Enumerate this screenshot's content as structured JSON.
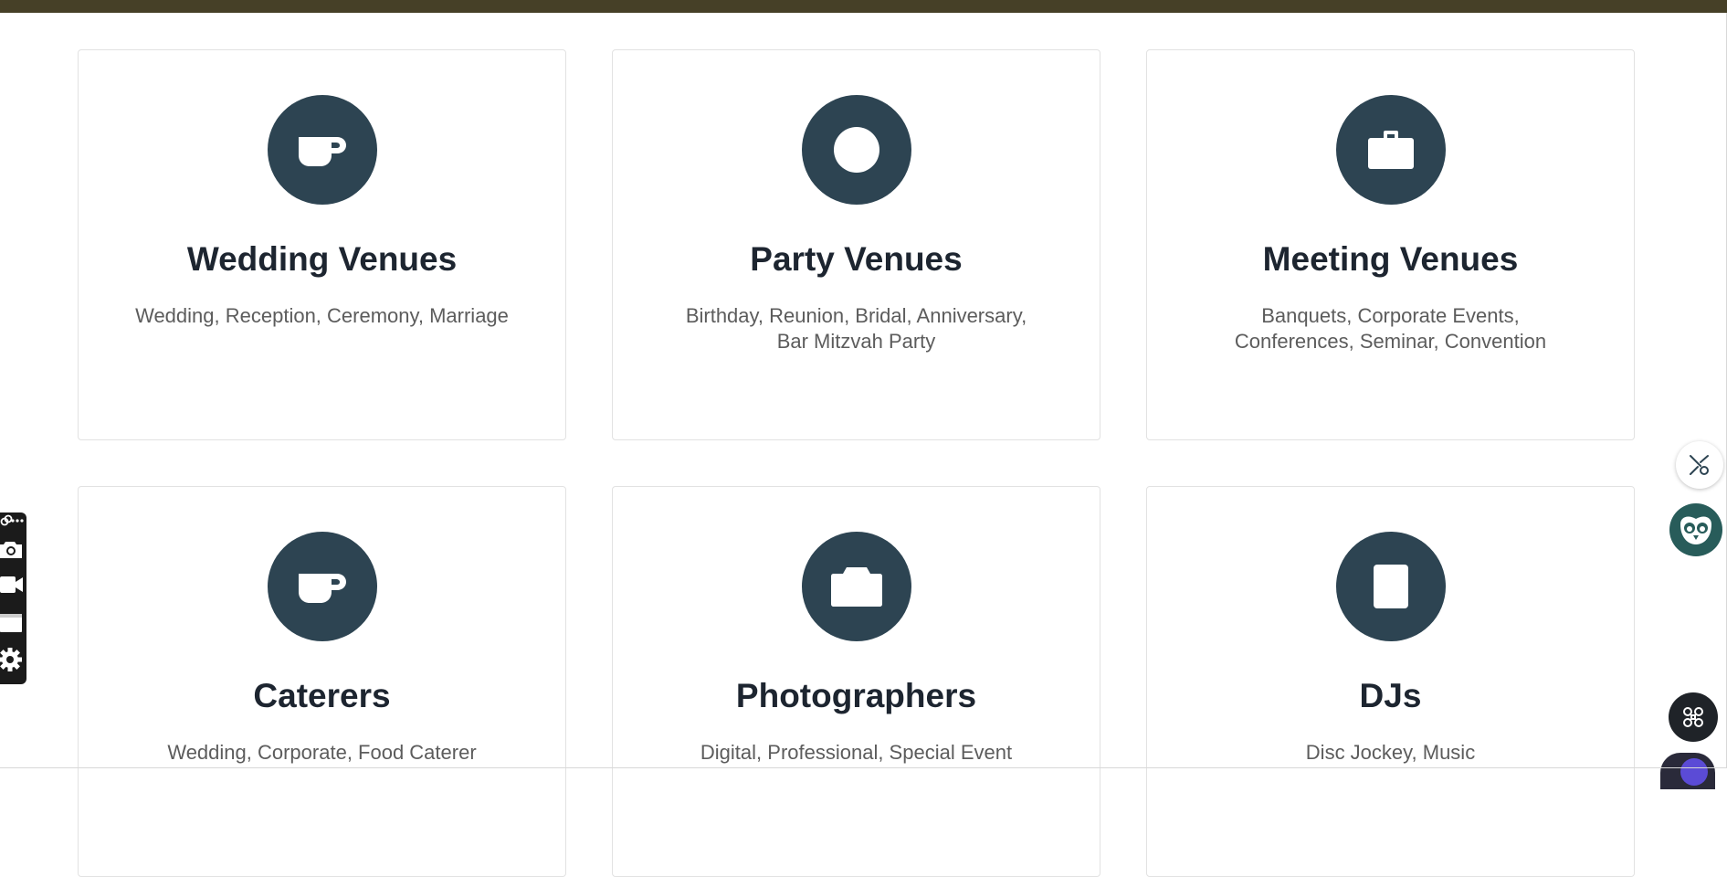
{
  "colors": {
    "top_bar": "#464027",
    "icon_circle": "#2d4452",
    "title_text": "#1d2530",
    "desc_text": "#5c5c5c"
  },
  "categories": [
    {
      "title": "Wedding Venues",
      "description": "Wedding, Reception, Ceremony, Marriage",
      "icon": "coffee-cup-icon"
    },
    {
      "title": "Party Venues",
      "description": "Birthday, Reunion, Bridal, Anniversary, Bar Mitzvah Party",
      "icon": "circle-icon"
    },
    {
      "title": "Meeting Venues",
      "description": "Banquets, Corporate Events, Conferences, Seminar, Convention",
      "icon": "briefcase-icon"
    },
    {
      "title": "Caterers",
      "description": "Wedding, Corporate, Food Caterer",
      "icon": "coffee-cup-icon"
    },
    {
      "title": "Photographers",
      "description": "Digital, Professional, Special Event",
      "icon": "camera-icon"
    },
    {
      "title": "DJs",
      "description": "Disc Jockey, Music",
      "icon": "tablet-icon"
    }
  ],
  "floating_widgets": {
    "camera_toolbar_icons": [
      "link-icon",
      "more-icon",
      "camera-icon",
      "video-camera-icon",
      "window-icon",
      "gear-icon"
    ],
    "share_button_icon": "share-network-icon",
    "assistant_button_icon": "owl-icon",
    "apps_button_icon": "command-grid-icon"
  }
}
